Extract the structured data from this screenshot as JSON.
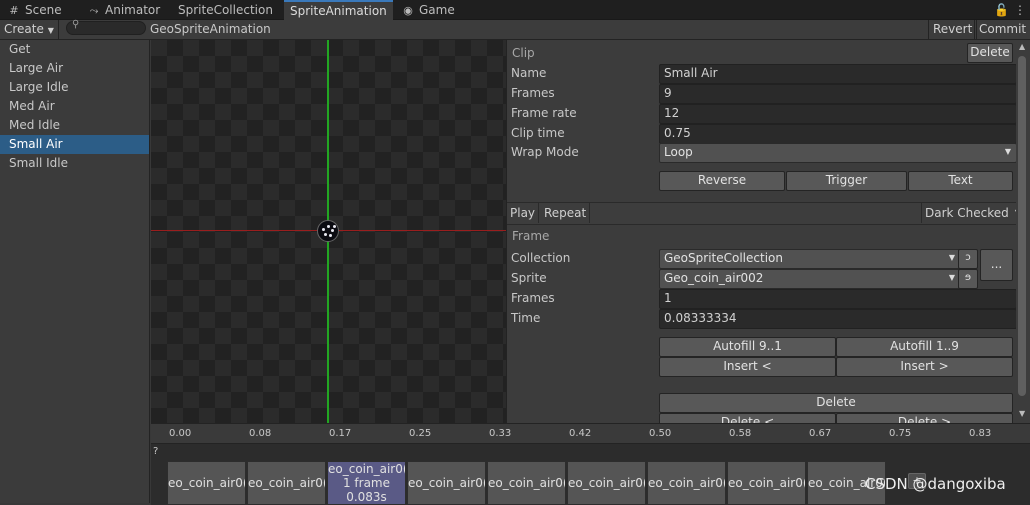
{
  "tabs": [
    {
      "icon": "grid-icon",
      "label": "Scene"
    },
    {
      "icon": "animator-icon",
      "label": "Animator"
    },
    {
      "icon": "",
      "label": "SpriteCollection"
    },
    {
      "icon": "",
      "label": "SpriteAnimation"
    },
    {
      "icon": "gamepad-icon",
      "label": "Game"
    }
  ],
  "toolbar": {
    "create_label": "Create",
    "search_placeholder": "",
    "asset_name": "GeoSpriteAnimation",
    "revert_label": "Revert",
    "commit_label": "Commit"
  },
  "clips": [
    "Get",
    "Large Air",
    "Large Idle",
    "Med Air",
    "Med Idle",
    "Small Air",
    "Small Idle"
  ],
  "selected_clip": "Small Air",
  "clip": {
    "header": "Clip",
    "delete_label": "Delete",
    "name_label": "Name",
    "name_value": "Small Air",
    "frames_label": "Frames",
    "frames_value": "9",
    "framerate_label": "Frame rate",
    "framerate_value": "12",
    "cliptime_label": "Clip time",
    "cliptime_value": "0.75",
    "wrapmode_label": "Wrap Mode",
    "wrapmode_value": "Loop",
    "reverse_label": "Reverse",
    "trigger_label": "Trigger",
    "text_label": "Text"
  },
  "playbar": {
    "play": "Play",
    "repeat": "Repeat",
    "background": "Dark Checked"
  },
  "frame": {
    "header": "Frame",
    "collection_label": "Collection",
    "collection_value": "GeoSpriteCollection",
    "sprite_label": "Sprite",
    "sprite_value": "Geo_coin_air002",
    "frames_label": "Frames",
    "frames_value": "1",
    "time_label": "Time",
    "time_value": "0.08333334",
    "more_label": "...",
    "autofill_desc": "Autofill 9..1",
    "autofill_asc": "Autofill 1..9",
    "insert_before": "Insert <",
    "insert_after": "Insert >",
    "delete_label": "Delete",
    "delete_before": "Delete <",
    "delete_after": "Delete >"
  },
  "timeline": {
    "ticks": [
      "0.00",
      "0.08",
      "0.17",
      "0.25",
      "0.33",
      "0.42",
      "0.50",
      "0.58",
      "0.67",
      "0.75",
      "0.83"
    ],
    "help": "?",
    "frames": [
      {
        "name": "eo_coin_air0(",
        "selected": false
      },
      {
        "name": "eo_coin_air0(",
        "selected": false
      },
      {
        "name": "eo_coin_air0(",
        "count": "1 frame",
        "time": "0.083s",
        "selected": true
      },
      {
        "name": "eo_coin_air0(",
        "selected": false
      },
      {
        "name": "eo_coin_air0(",
        "selected": false
      },
      {
        "name": "eo_coin_air0(",
        "selected": false
      },
      {
        "name": "eo_coin_air0(",
        "selected": false
      },
      {
        "name": "eo_coin_air0(",
        "selected": false
      },
      {
        "name": "eo_coin_air0(",
        "selected": false
      }
    ],
    "add_label": "+"
  },
  "watermark": "CSDN @dangoxiba",
  "colors": {
    "accent": "#3a79bb",
    "selection": "#2c5d87",
    "frame_selected": "#5a5a86",
    "axis_x": "#9a1e1e",
    "axis_y": "#22a622"
  }
}
